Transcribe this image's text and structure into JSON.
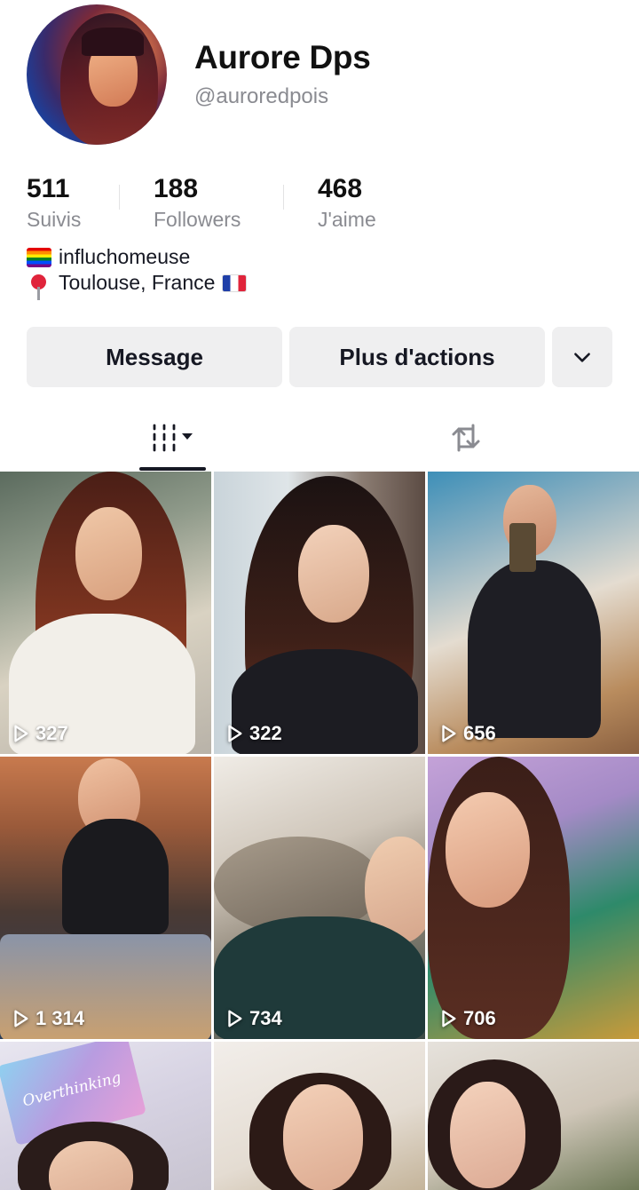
{
  "profile": {
    "name": "Aurore Dps",
    "handle": "@auroredpois"
  },
  "stats": [
    {
      "value": "511",
      "label": "Suivis"
    },
    {
      "value": "188",
      "label": "Followers"
    },
    {
      "value": "468",
      "label": "J'aime"
    }
  ],
  "bio": {
    "line1": "influchomeuse",
    "line2": "Toulouse, France"
  },
  "actions": {
    "message_label": "Message",
    "more_label": "Plus d'actions"
  },
  "tabs": [
    {
      "icon": "videos-grid-icon",
      "active": true
    },
    {
      "icon": "repost-icon",
      "active": false
    }
  ],
  "videos": [
    {
      "views": "327"
    },
    {
      "views": "322"
    },
    {
      "views": "656"
    },
    {
      "views": "1 314"
    },
    {
      "views": "734"
    },
    {
      "views": "706"
    },
    {
      "views": "",
      "sticker": "Overthinking"
    },
    {
      "views": ""
    },
    {
      "views": ""
    }
  ],
  "colors": {
    "text_primary": "#161823",
    "text_secondary": "#8a8b91",
    "button_bg": "#efeff0"
  }
}
